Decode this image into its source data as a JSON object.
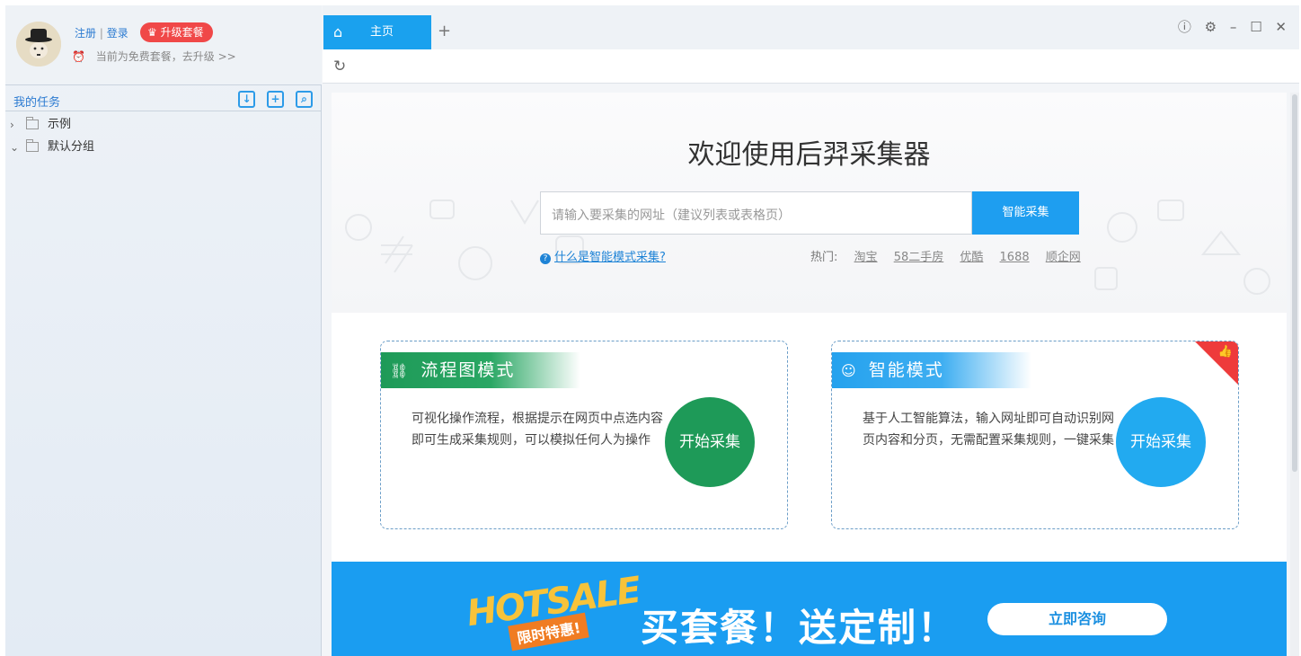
{
  "user": {
    "register": "注册",
    "separator": "|",
    "login": "登录",
    "upgrade_label": "升级套餐",
    "plan_note": "当前为免费套餐，去升级 >>"
  },
  "tasks": {
    "title": "我的任务",
    "tree": [
      {
        "label": "示例",
        "expanded": false
      },
      {
        "label": "默认分组",
        "expanded": true
      }
    ]
  },
  "tabs": [
    {
      "label": "主页",
      "active": true
    }
  ],
  "hero": {
    "title": "欢迎使用后羿采集器",
    "search_placeholder": "请输入要采集的网址（建议列表或表格页）",
    "search_button": "智能采集",
    "help_link": "什么是智能模式采集?",
    "hot_label": "热门:",
    "hot_links": [
      "淘宝",
      "58二手房",
      "优酷",
      "1688",
      "顺企网"
    ]
  },
  "cards": [
    {
      "title": "流程图模式",
      "description": "可视化操作流程，根据提示在网页中点选内容即可生成采集规则，可以模拟任何人为操作",
      "button": "开始采集",
      "color": "#1e9a58"
    },
    {
      "title": "智能模式",
      "description": "基于人工智能算法，输入网址即可自动识别网页内容和分页，无需配置采集规则，一键采集",
      "button": "开始采集",
      "color": "#22aaf0"
    }
  ],
  "banner": {
    "logo_text": "HOTSALE",
    "logo_sub": "限时特惠!",
    "title": "买套餐！送定制！",
    "button": "立即咨询"
  },
  "colors": {
    "accent": "#1aa1ee",
    "danger": "#f04848",
    "green": "#1e9a58"
  }
}
